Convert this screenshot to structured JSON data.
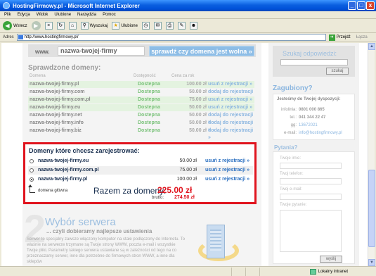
{
  "window": {
    "title": "HostingFirmowy.pl - Microsoft Internet Explorer",
    "controls": [
      "_",
      "□",
      "x"
    ]
  },
  "menu": [
    "Plik",
    "Edycja",
    "Widok",
    "Ulubione",
    "Narzędzia",
    "Pomoc"
  ],
  "toolbar": {
    "back": "Wstecz",
    "search": "Wyszukaj",
    "favorites": "Ulubione"
  },
  "address": {
    "label": "Adres",
    "url": "http://www.hostingfirmowy.pl/",
    "go": "Przejdź",
    "links": "Łącza"
  },
  "domain_search": {
    "prefix": "www.",
    "value": "nazwa-twojej-firmy",
    "button": "sprawdź czy domena jest wolna »"
  },
  "checked": {
    "title": "Sprawdzone domeny:",
    "headers": [
      "Domena",
      "Dostępność",
      "Cena za rok"
    ],
    "rows": [
      {
        "domain": "nazwa-twojej-firmy.pl",
        "status": "Dostepna",
        "price": "100.00 zł",
        "action": "usuń z rejestracji »",
        "selected": true
      },
      {
        "domain": "nazwa-twojej-firmy.com",
        "status": "Dostepna",
        "price": "50.00 zł",
        "action": "dodaj do rejestracji »",
        "selected": false
      },
      {
        "domain": "nazwa-twojej-firmy.com.pl",
        "status": "Dostepna",
        "price": "75.00 zł",
        "action": "usuń z rejestracji »",
        "selected": true
      },
      {
        "domain": "nazwa-twojej-firmy.eu",
        "status": "Dostepna",
        "price": "50.00 zł",
        "action": "usuń z rejestracji »",
        "selected": true
      },
      {
        "domain": "nazwa-twojej-firmy.net",
        "status": "Dostepna",
        "price": "50.00 zł",
        "action": "dodaj do rejestracji »",
        "selected": false
      },
      {
        "domain": "nazwa-twojej-firmy.info",
        "status": "Dostepna",
        "price": "50.00 zł",
        "action": "dodaj do rejestracji »",
        "selected": false
      },
      {
        "domain": "nazwa-twojej-firmy.biz",
        "status": "Dostepna",
        "price": "50.00 zł",
        "action": "dodaj do rejestracji »",
        "selected": false
      }
    ]
  },
  "selected": {
    "title": "Domeny które chcesz zarejestrować:",
    "rows": [
      {
        "domain": "nazwa-twojej-firmy.eu",
        "price": "50.00 zł",
        "action": "usuń z rejestracji »",
        "main": false
      },
      {
        "domain": "nazwa-twojej-firmy.com.pl",
        "price": "75.00 zł",
        "action": "usuń z rejestracji »",
        "main": false
      },
      {
        "domain": "nazwa-twojej-firmy.pl",
        "price": "100.00 zł",
        "action": "usuń z rejestracji »",
        "main": true
      }
    ],
    "main_label": "domena główna",
    "total_label": "Razem za domeny:",
    "total_value": "225.00 zł",
    "gross_label": "brutto:",
    "gross_value": "274.50 zł"
  },
  "step2": {
    "number": "2",
    "title": "Wybór serwera",
    "subtitle": "... czyli dobieramy najlepsze ustawienia",
    "body": "Serwer to specjalny zawsze włączony komputer na stałe podłączony do Internetu. To właśnie na serwerze trzymane są Twoje strony WWW, poczta e-mail i wszystkie Twoje pliki. Parametry takiego serwera ustawiane są w zależności od tego na co przeznaczamy serwer, inne dla potrzebne do firmowych stron WWW, a inne dla sklepów"
  },
  "sidebar": {
    "search_title": "Szukaj odpowiedzi:",
    "search_button": "szukaj",
    "lost_title": "Zagubiony?",
    "contact_head": "Jesteśmy do Twojej dyspozycji:",
    "contacts": [
      {
        "key": "infolinia:",
        "value": "0801 000 865"
      },
      {
        "key": "tel.:",
        "value": "041 344 22 47"
      },
      {
        "key": "gg:",
        "value": "13672021"
      },
      {
        "key": "e-mail:",
        "value": "info@hostingfirmowy.pl"
      }
    ],
    "questions_title": "Pytania?",
    "fields": [
      "Twoje imie:",
      "Twoj telefon:",
      "Twoj e-mail:",
      "Twoje pytanie:"
    ],
    "send": "wyślij"
  },
  "status": {
    "zone": "Lokalny intranet"
  },
  "colors": {
    "accent_red": "#e0141e",
    "link_blue": "#2a6fc0",
    "available_green": "#7ac27a"
  }
}
